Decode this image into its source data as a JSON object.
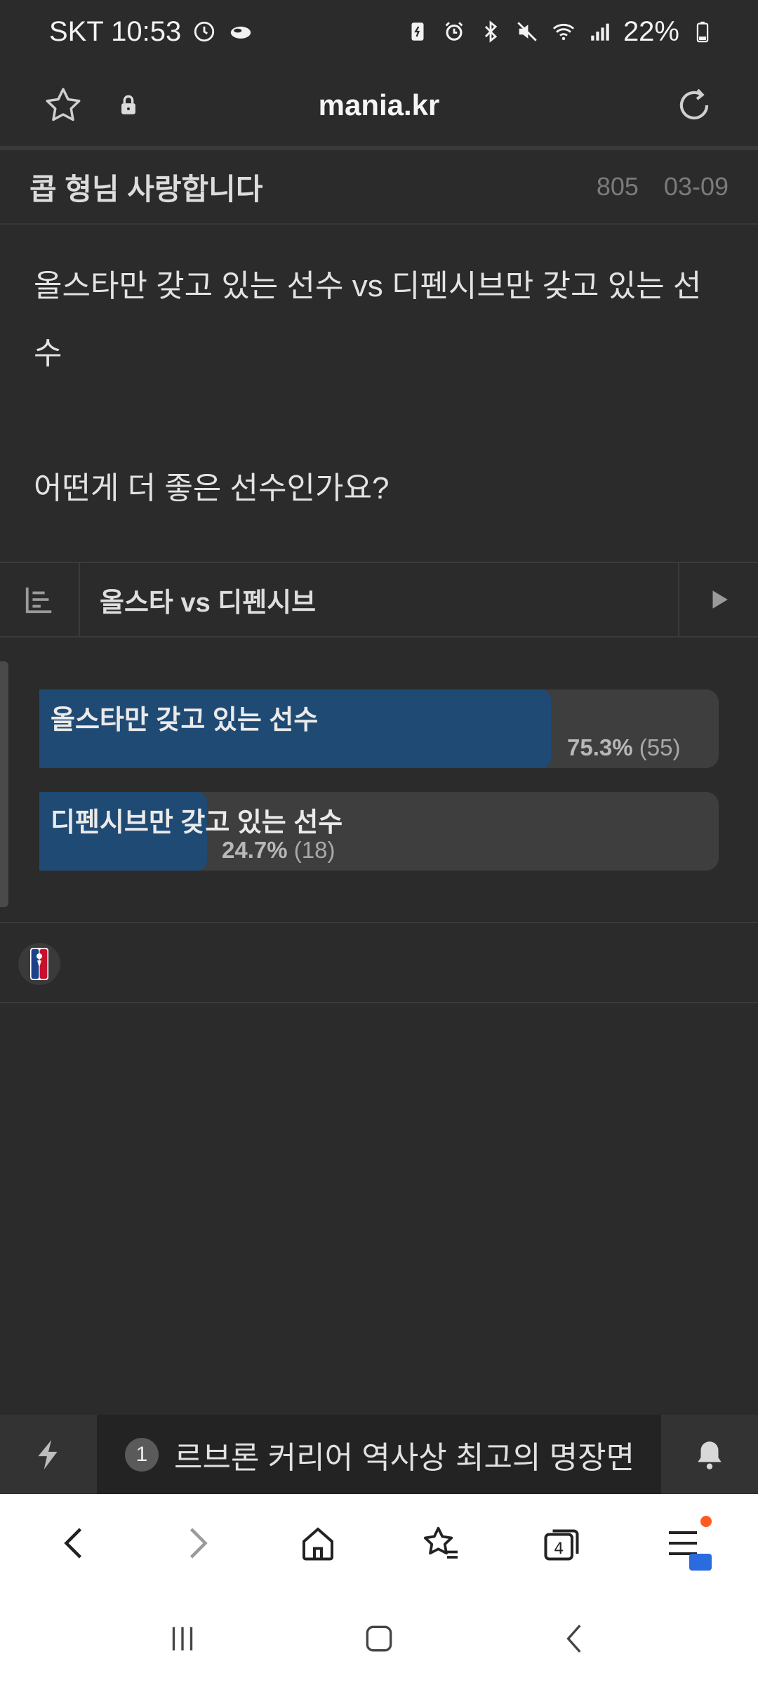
{
  "status_bar": {
    "carrier_time": "SKT 10:53",
    "battery": "22%"
  },
  "url_bar": {
    "domain": "mania.kr"
  },
  "post": {
    "title": "콥 형님 사랑합니다",
    "views": "805",
    "date": "03-09",
    "body_line1": "올스타만 갖고 있는 선수 vs 디펜시브만 갖고 있는 선",
    "body_line2": "수",
    "body_line3": "어떤게 더 좋은 선수인가요?"
  },
  "poll": {
    "title": "올스타 vs 디펜시브",
    "options": [
      {
        "label": "올스타만 갖고 있는 선수",
        "percent": "75.3%",
        "count": "(55)",
        "fraction": 0.753
      },
      {
        "label": "디펜시브만 갖고 있는 선수",
        "percent": "24.7%",
        "count": "(18)",
        "fraction": 0.247
      }
    ]
  },
  "ticker": {
    "rank": "1",
    "headline": "르브론 커리어 역사상 최고의 명장면"
  },
  "browser_nav": {
    "tab_count": "4"
  },
  "colors": {
    "background": "#2b2b2b",
    "poll_fill": "#1f4a74",
    "poll_track": "#3e3e3e",
    "menu_dot": "#ff5a1f"
  }
}
